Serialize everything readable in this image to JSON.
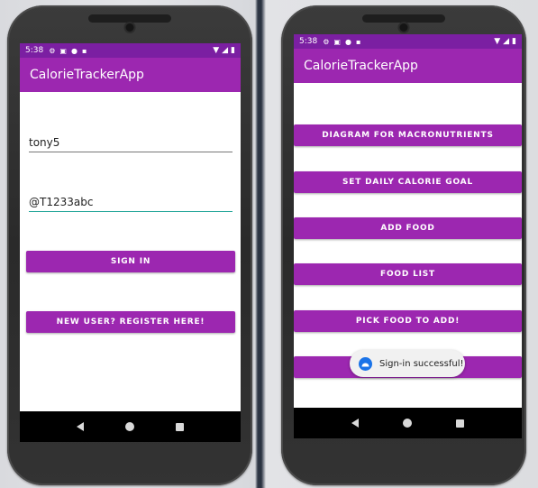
{
  "left_phone": {
    "status": {
      "time": "5:38"
    },
    "app_title": "CalorieTrackerApp",
    "username_value": "tony5",
    "password_value": "@T1233abc",
    "sign_in_label": "SIGN IN",
    "register_label": "NEW USER? REGISTER HERE!"
  },
  "right_phone": {
    "status": {
      "time": "5:38"
    },
    "app_title": "CalorieTrackerApp",
    "buttons": [
      {
        "label": "DIAGRAM FOR MACRONUTRIENTS"
      },
      {
        "label": "SET DAILY CALORIE GOAL"
      },
      {
        "label": "ADD FOOD"
      },
      {
        "label": "FOOD LIST"
      },
      {
        "label": "PICK FOOD TO ADD!"
      },
      {
        "label": ""
      }
    ],
    "toast_text": "Sign-in successful!"
  },
  "colors": {
    "primary": "#9c27b0",
    "primary_dark": "#7b1fa2",
    "field_accent": "#26a69a"
  },
  "icons": [
    "settings-icon",
    "a-icon",
    "mic-icon",
    "sd-card-icon",
    "wifi-icon",
    "signal-icon",
    "battery-icon",
    "back-icon",
    "home-icon",
    "recents-icon",
    "android-icon"
  ]
}
